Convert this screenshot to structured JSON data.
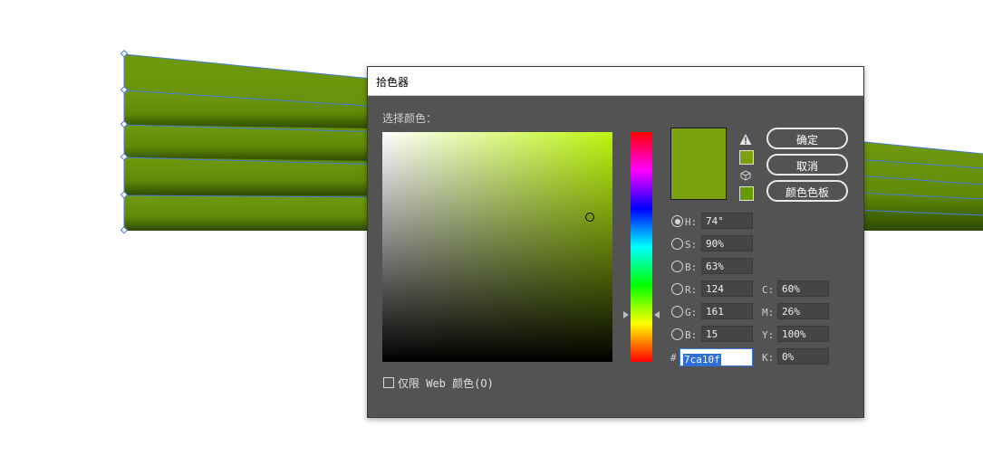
{
  "dialog": {
    "title": "拾色器",
    "select_label": "选择颜色：",
    "current_color": "#7ca10f",
    "pure_hue_color": "#bdf50f",
    "web_safe_color": "#669900"
  },
  "buttons": {
    "ok": "确定",
    "cancel": "取消",
    "swatches": "颜色色板"
  },
  "hsb": [
    {
      "label": "H:",
      "value": "74°",
      "selected": true
    },
    {
      "label": "S:",
      "value": "90%",
      "selected": false
    },
    {
      "label": "B:",
      "value": "63%",
      "selected": false
    }
  ],
  "rgb": [
    {
      "label": "R:",
      "value": "124",
      "selected": false
    },
    {
      "label": "G:",
      "value": "161",
      "selected": false
    },
    {
      "label": "B:",
      "value": "15",
      "selected": false
    }
  ],
  "cmyk": [
    {
      "label": "C:",
      "value": "60%"
    },
    {
      "label": "M:",
      "value": "26%"
    },
    {
      "label": "Y:",
      "value": "100%"
    },
    {
      "label": "K:",
      "value": "0%"
    }
  ],
  "hex": {
    "label": "#",
    "value": "7ca10f"
  },
  "web_only": {
    "label": "仅限 Web 颜色(O)",
    "checked": false
  },
  "icons": {
    "warning": "gamut-warning-icon",
    "web": "web-safe-cube-icon"
  }
}
